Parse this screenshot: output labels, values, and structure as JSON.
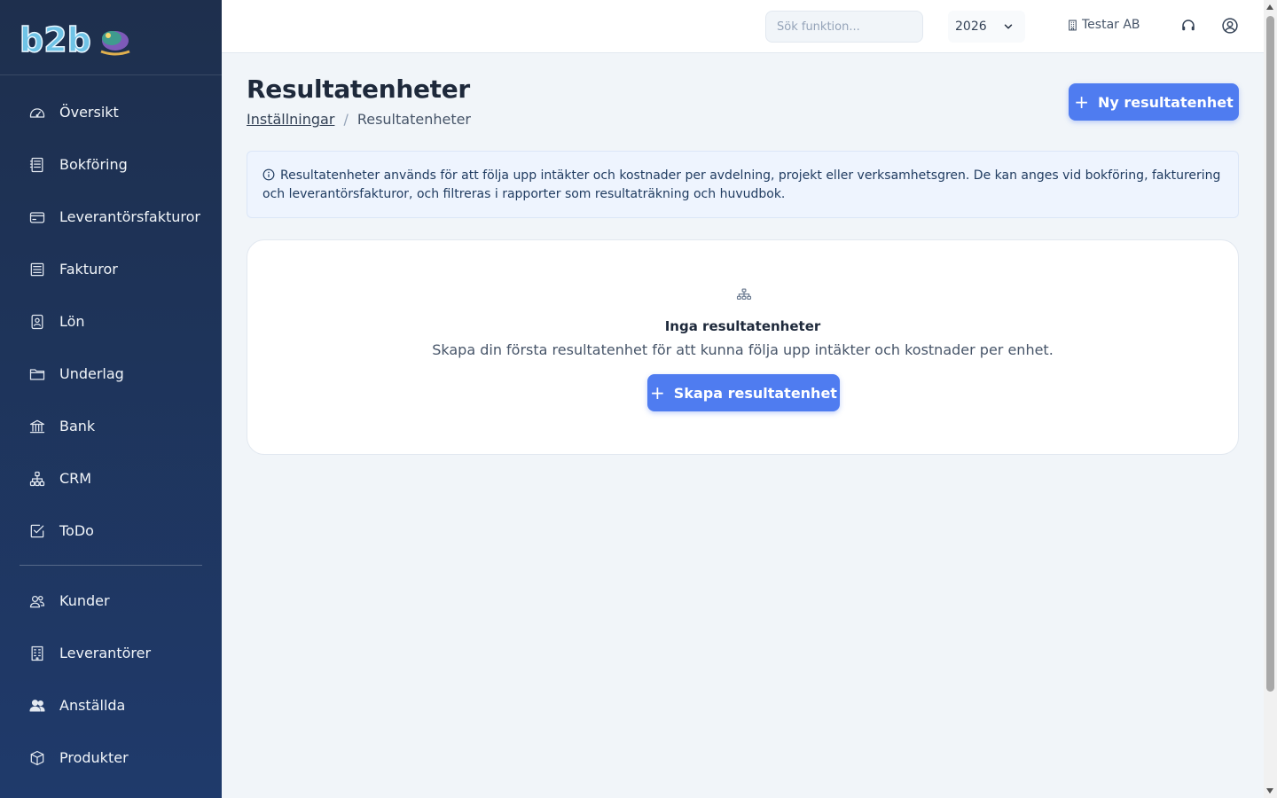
{
  "brand": {
    "logo_text": "b2b",
    "accent_color": "#4f7cf0",
    "sidebar_color": "#1f3a6b"
  },
  "sidebar": {
    "items": [
      {
        "label": "Översikt",
        "icon": "gauge-icon"
      },
      {
        "label": "Bokföring",
        "icon": "ledger-icon"
      },
      {
        "label": "Leverantörsfakturor",
        "icon": "credit-card-icon"
      },
      {
        "label": "Fakturor",
        "icon": "invoice-icon"
      },
      {
        "label": "Lön",
        "icon": "badge-icon"
      },
      {
        "label": "Underlag",
        "icon": "folder-icon"
      },
      {
        "label": "Bank",
        "icon": "bank-icon"
      },
      {
        "label": "CRM",
        "icon": "network-icon"
      },
      {
        "label": "ToDo",
        "icon": "checkbox-icon"
      }
    ],
    "secondary_items": [
      {
        "label": "Kunder",
        "icon": "users-icon"
      },
      {
        "label": "Leverantörer",
        "icon": "building-icon"
      },
      {
        "label": "Anställda",
        "icon": "people-icon"
      },
      {
        "label": "Produkter",
        "icon": "box-icon"
      }
    ]
  },
  "topbar": {
    "search_placeholder": "Sök funktion...",
    "year": "2026",
    "company": "Testar AB"
  },
  "page": {
    "title": "Resultatenheter",
    "breadcrumb_parent": "Inställningar",
    "breadcrumb_sep": "/",
    "breadcrumb_current": "Resultatenheter",
    "new_button_label": "Ny resultatenhet",
    "info_text": "Resultatenheter används för att följa upp intäkter och kostnader per avdelning, projekt eller verksamhetsgren. De kan anges vid bokföring, fakturering och leverantörsfakturor, och filtreras i rapporter som resultaträkning och huvudbok."
  },
  "empty_state": {
    "title": "Inga resultatenheter",
    "description": "Skapa din första resultatenhet för att kunna följa upp intäkter och kostnader per enhet.",
    "button_label": "Skapa resultatenhet"
  }
}
